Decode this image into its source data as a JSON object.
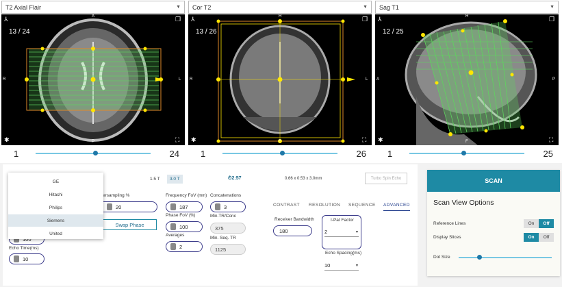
{
  "viewers": [
    {
      "title": "T2 Axial Flair",
      "slice": "13 / 24",
      "min": "1",
      "max": "24",
      "orient": {
        "top": "A",
        "bottom": "P",
        "left": "R",
        "right": "L"
      },
      "thumb": 0.5
    },
    {
      "title": "Cor T2",
      "slice": "13 / 26",
      "min": "1",
      "max": "26",
      "orient": {
        "top": "H",
        "bottom": "F",
        "left": "R",
        "right": "L"
      },
      "thumb": 0.5
    },
    {
      "title": "Sag T1",
      "slice": "12 / 25",
      "min": "1",
      "max": "25",
      "orient": {
        "top": "H",
        "bottom": "F",
        "left": "A",
        "right": "P"
      },
      "thumb": 0.45
    }
  ],
  "header_bar": {
    "field_15": "1.5 T",
    "field_30": "3.0 T",
    "time": "2:57",
    "voxel": "0.66 x 0.53 x 3.0mm",
    "sequence_btn": "Turbo Spin Echo"
  },
  "dropdown": {
    "options": [
      "GE",
      "Hitachi",
      "Philips",
      "Siemens",
      "United"
    ],
    "selected": "Siemens"
  },
  "params": {
    "oversampling_label": "ersampling %",
    "oversampling": "20",
    "swap_phase": "Swap Phase",
    "echo_time_label": "Echo Time(ms)",
    "echo_time": "10",
    "partial_value": "100",
    "freq_fov_label": "Frequency FoV",
    "freq_fov_unit": "(mm)",
    "freq_fov": "187",
    "phase_fov_label": "Phase FoV",
    "phase_fov_unit": "(%)",
    "phase_fov": "100",
    "averages_label": "Averages",
    "averages": "2",
    "concat_label": "Concatenations",
    "concat": "3",
    "min_tr_label": "Min.TR/Conc",
    "min_tr": "375",
    "min_seq_label": "Min. Seq. TR",
    "min_seq": "1125",
    "bandwidth_label": "Receiver Bandwidth",
    "bandwidth": "180",
    "ipat_label": "I-Pat Factor",
    "ipat": "2",
    "echo_spacing_label": "Echo Spacing(ms)",
    "echo_spacing": "10"
  },
  "tabs": [
    "CONTRAST",
    "RESOLUTION",
    "SEQUENCE",
    "ADVANCED"
  ],
  "active_tab": "ADVANCED",
  "right": {
    "scan": "SCAN",
    "title": "Scan View Options",
    "ref_lines": "Reference Lines",
    "display_slices": "Display Slices",
    "dot_size": "Dot Size",
    "on": "On",
    "off": "Off",
    "dot_size_value": 0.2
  },
  "colors": {
    "accent": "#1e8aa4",
    "overlay": "#5fd35f",
    "handle": "#ffe600"
  }
}
